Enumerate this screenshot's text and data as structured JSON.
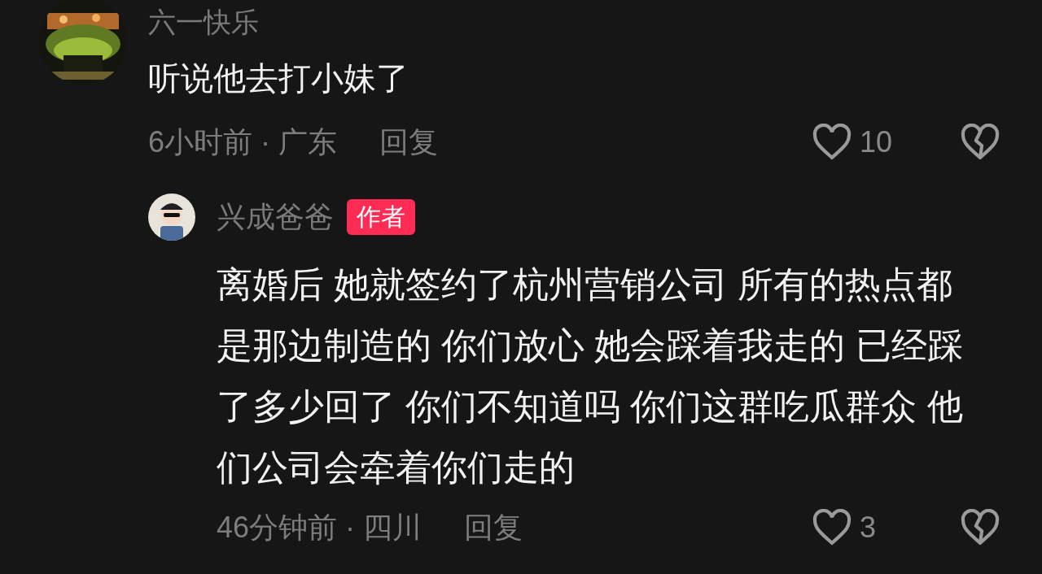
{
  "comments": [
    {
      "user": "六一快乐",
      "text": "听说他去打小妹了",
      "meta": "6小时前 · 广东",
      "reply_label": "回复",
      "likes": "10",
      "replies": [
        {
          "user": "兴成爸爸",
          "badge": "作者",
          "text": "离婚后 她就签约了杭州营销公司 所有的热点都是那边制造的 你们放心 她会踩着我走的 已经踩了多少回了 你们不知道吗 你们这群吃瓜群众 他们公司会牵着你们走的",
          "meta": "46分钟前 · 四川",
          "reply_label": "回复",
          "likes": "3"
        }
      ]
    }
  ]
}
